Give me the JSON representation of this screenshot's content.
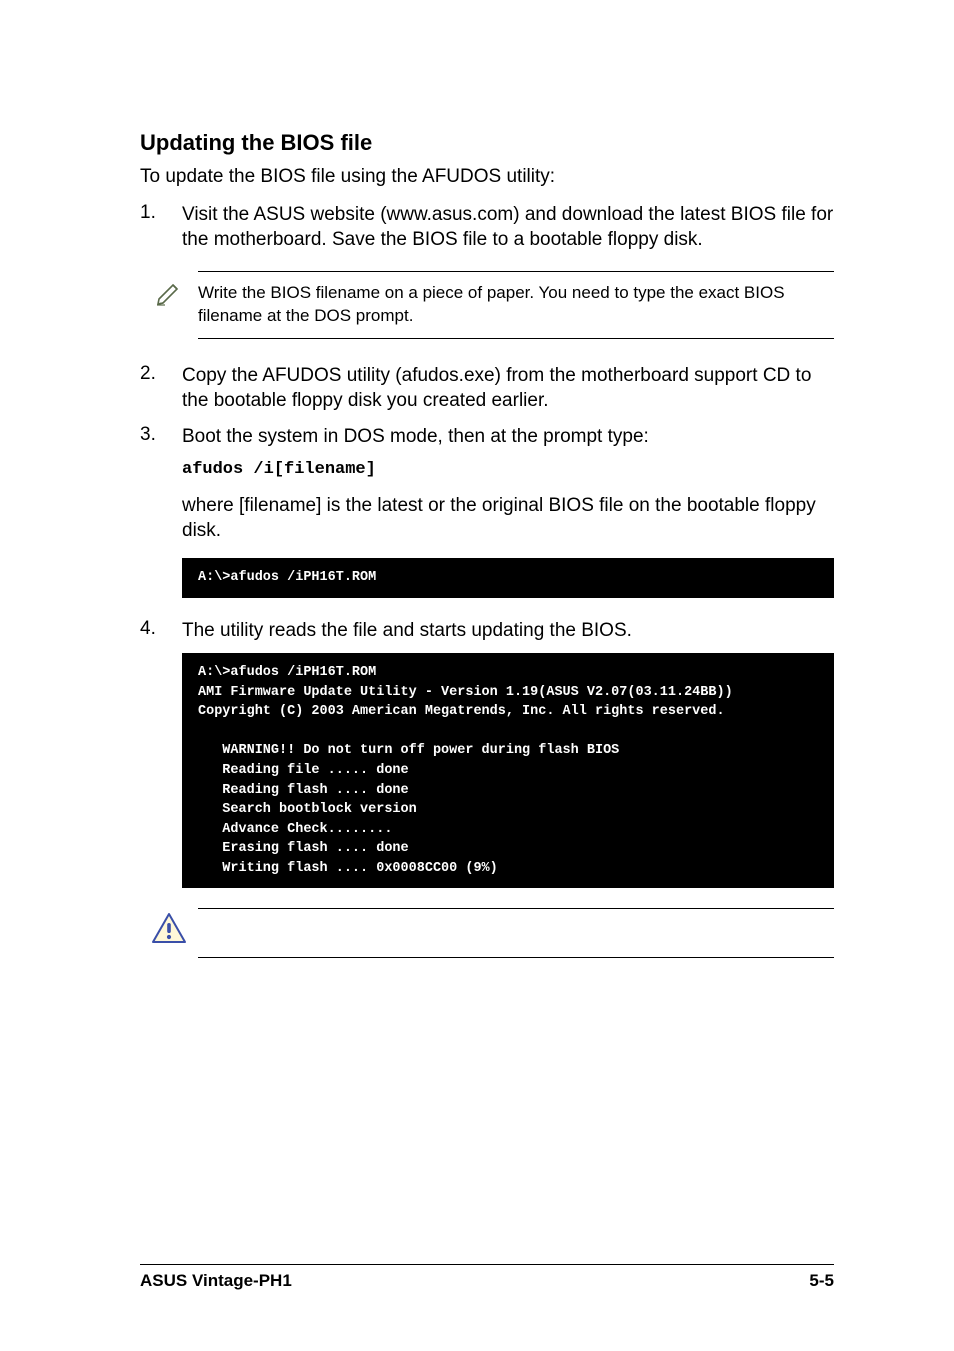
{
  "heading": "Updating the BIOS file",
  "intro": "To update the BIOS file using the AFUDOS utility:",
  "step1": {
    "num": "1.",
    "text": "Visit the ASUS website (www.asus.com) and download the latest BIOS file for the motherboard. Save the BIOS file to a bootable floppy disk."
  },
  "note1": "Write the BIOS filename on a piece of paper. You need to type the exact BIOS filename at the DOS prompt.",
  "step2": {
    "num": "2.",
    "text": "Copy the AFUDOS utility (afudos.exe) from the motherboard support CD to the bootable floppy disk you created earlier."
  },
  "step3": {
    "num": "3.",
    "text": "Boot the system in DOS mode, then at the prompt type:",
    "cmd": "afudos /i[filename]",
    "after": "where [filename] is the latest or the original BIOS file on the bootable floppy disk."
  },
  "terminal1": "A:\\>afudos /iPH16T.ROM",
  "step4": {
    "num": "4.",
    "text": "The utility reads the file and starts updating the BIOS."
  },
  "terminal2": "A:\\>afudos /iPH16T.ROM\nAMI Firmware Update Utility - Version 1.19(ASUS V2.07(03.11.24BB))\nCopyright (C) 2003 American Megatrends, Inc. All rights reserved.\n\n   WARNING!! Do not turn off power during flash BIOS\n   Reading file ..... done\n   Reading flash .... done\n   Search bootblock version\n   Advance Check........\n   Erasing flash .... done\n   Writing flash .... 0x0008CC00 (9%)",
  "footer": {
    "left": "ASUS Vintage-PH1",
    "right": "5-5"
  }
}
